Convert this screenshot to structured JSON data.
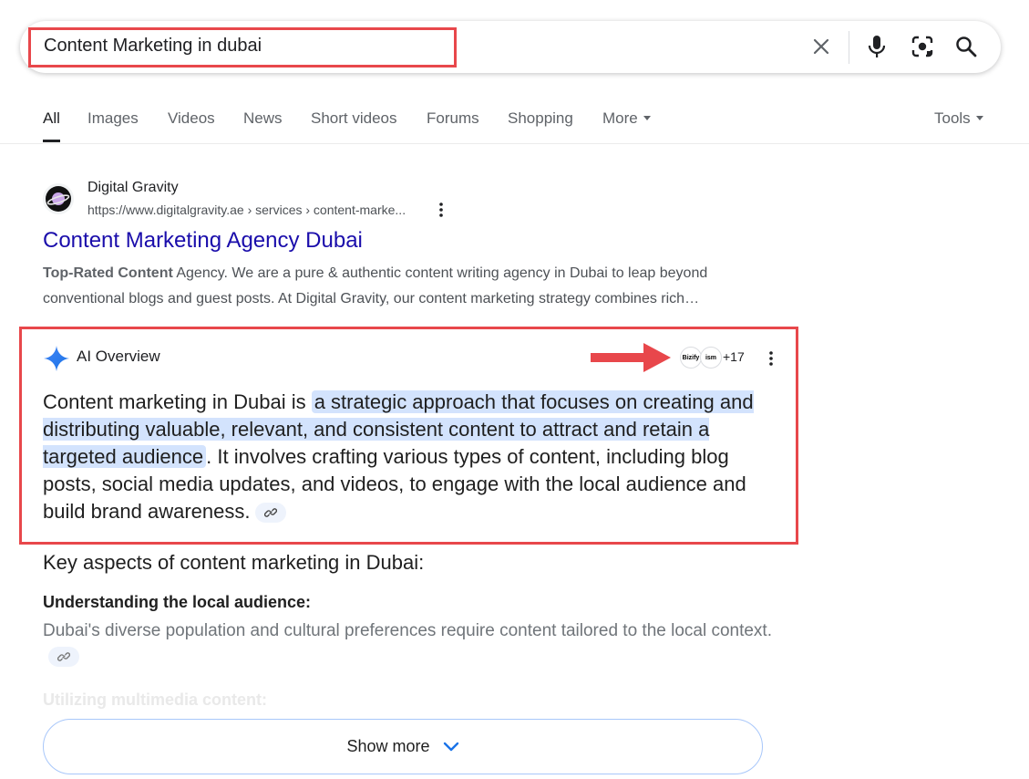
{
  "search": {
    "query": "Content Marketing in dubai"
  },
  "tabs": [
    {
      "label": "All",
      "active": true
    },
    {
      "label": "Images"
    },
    {
      "label": "Videos"
    },
    {
      "label": "News"
    },
    {
      "label": "Short videos"
    },
    {
      "label": "Forums"
    },
    {
      "label": "Shopping"
    },
    {
      "label": "More"
    }
  ],
  "tools_label": "Tools",
  "result": {
    "site_name": "Digital Gravity",
    "url": "https://www.digitalgravity.ae › services › content-marke...",
    "title": "Content Marketing Agency Dubai",
    "snippet_bold": "Top-Rated Content",
    "snippet_rest": " Agency. We are a pure & authentic content writing agency in Dubai to leap beyond conventional blogs and guest posts. At Digital Gravity, our content marketing strategy combines rich…"
  },
  "ai_overview": {
    "label": "AI Overview",
    "source_badge_text": "Bizify",
    "source_badge_text2": "ism",
    "sources_count": "+17",
    "text_before": "Content marketing in Dubai is ",
    "text_highlight": "a strategic approach that focuses on creating and distributing valuable, relevant, and consistent content to attract and retain a targeted audience",
    "text_after": ". It involves crafting various types of content, including blog posts, social media updates, and videos, to engage with the local audience and build brand awareness."
  },
  "key_aspects": {
    "heading": "Key aspects of content marketing in Dubai:",
    "item1_title": "Understanding the local audience:",
    "item1_text": "Dubai's diverse population and cultural preferences require content tailored to the local context.",
    "item2_title": "Utilizing multimedia content:"
  },
  "show_more_label": "Show more",
  "colors": {
    "annotation_red": "#e8474b",
    "link_blue": "#1a0dab",
    "highlight": "#d3e3fd"
  }
}
